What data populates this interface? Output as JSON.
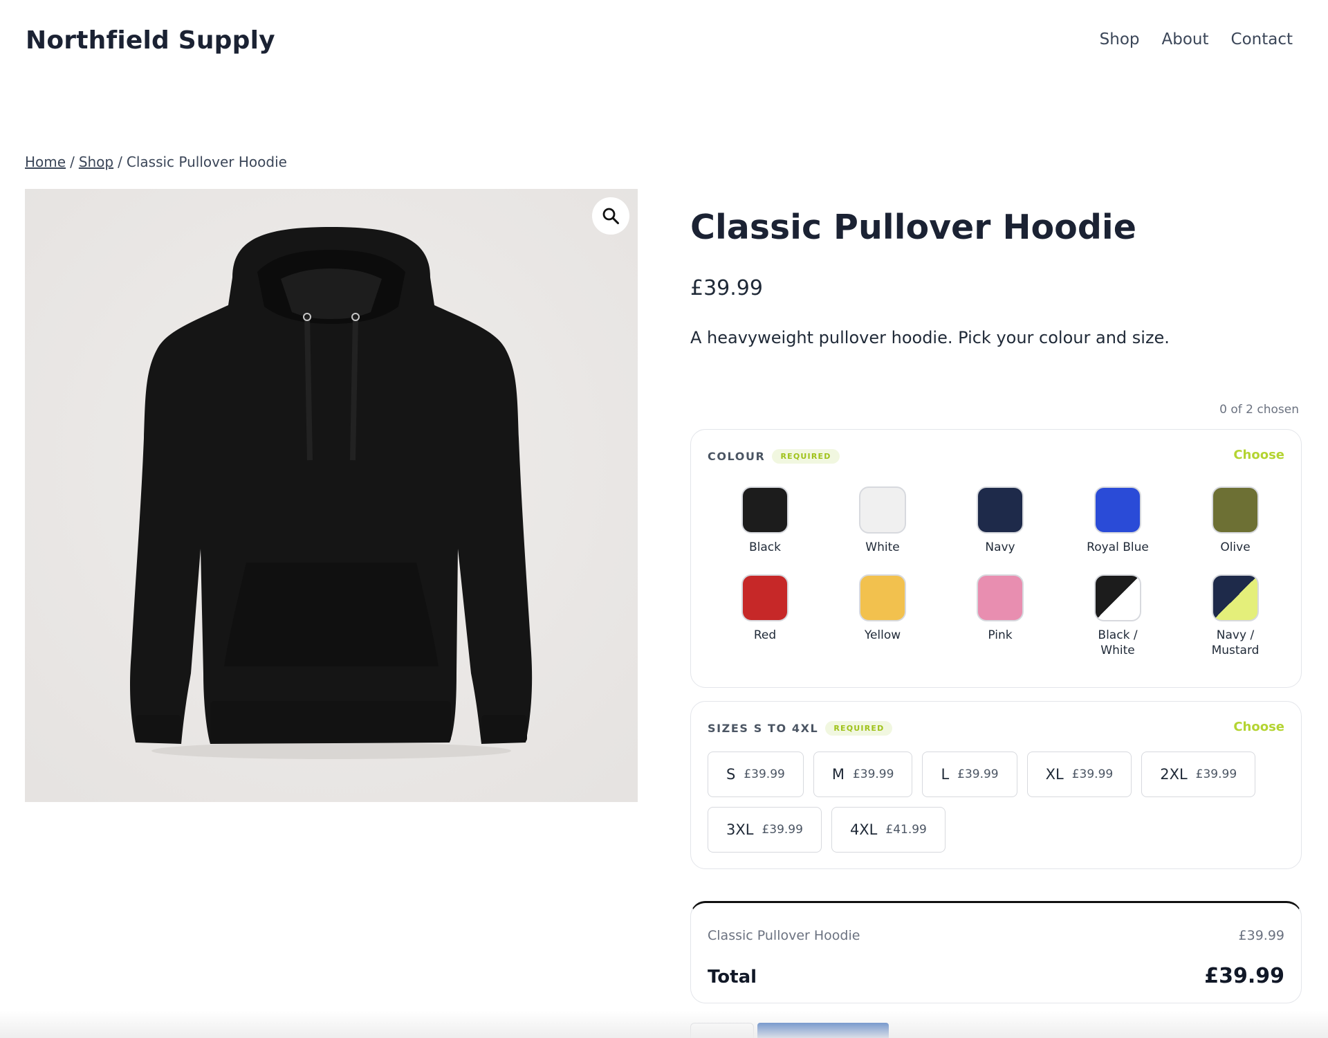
{
  "site": {
    "title": "Northfield Supply"
  },
  "nav": {
    "items": [
      "Shop",
      "About",
      "Contact"
    ]
  },
  "breadcrumb": {
    "home": "Home",
    "sep": "/",
    "shop": "Shop",
    "current": "Classic Pullover Hoodie"
  },
  "product": {
    "title": "Classic Pullover Hoodie",
    "price": "£39.99",
    "description": "A heavyweight pullover hoodie. Pick your colour and size.",
    "zoom_icon": "magnifier-icon"
  },
  "options": {
    "chosen_count": "0 of 2 chosen",
    "colour": {
      "label": "Colour",
      "required": "Required",
      "choose": "Choose",
      "swatches": [
        {
          "name": "Black",
          "color": "#1c1c1c"
        },
        {
          "name": "White",
          "color": "#f0f0f0"
        },
        {
          "name": "Navy",
          "color": "#1e2a4a"
        },
        {
          "name": "Royal Blue",
          "color": "#2a4bd7"
        },
        {
          "name": "Olive",
          "color": "#6d7034"
        },
        {
          "name": "Red",
          "color": "#c62828"
        },
        {
          "name": "Yellow",
          "color": "#f2c14e"
        },
        {
          "name": "Pink",
          "color": "#e88eb0"
        },
        {
          "name": "Black / White",
          "color": "#1c1c1c",
          "color2": "#ffffff"
        },
        {
          "name": "Navy / Mustard",
          "color": "#1e2a4a",
          "color2": "#e4ef7a"
        }
      ]
    },
    "sizes": {
      "label": "Sizes S to 4XL",
      "required": "Required",
      "choose": "Choose",
      "items": [
        {
          "name": "S",
          "price": "£39.99"
        },
        {
          "name": "M",
          "price": "£39.99"
        },
        {
          "name": "L",
          "price": "£39.99"
        },
        {
          "name": "XL",
          "price": "£39.99"
        },
        {
          "name": "2XL",
          "price": "£39.99"
        },
        {
          "name": "3XL",
          "price": "£39.99"
        },
        {
          "name": "4XL",
          "price": "£41.99"
        }
      ]
    }
  },
  "totals": {
    "line_label": "Classic Pullover Hoodie",
    "line_price": "£39.99",
    "total_label": "Total",
    "total_value": "£39.99"
  },
  "colors": {
    "accent": "#b4d432",
    "button": "#2b62b8",
    "text": "#1b2233"
  }
}
